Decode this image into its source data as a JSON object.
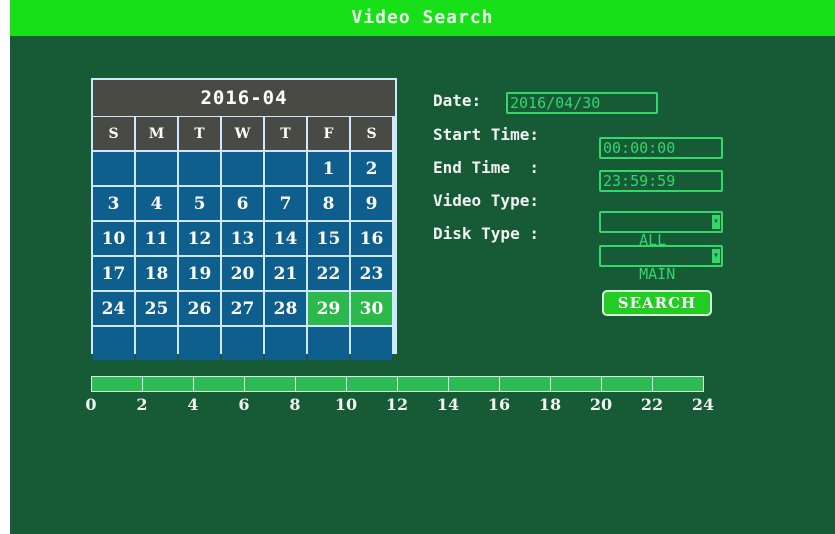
{
  "title": "Video Search",
  "calendar": {
    "month_label": "2016-04",
    "weekdays": [
      "S",
      "M",
      "T",
      "W",
      "T",
      "F",
      "S"
    ],
    "cells": [
      "",
      "",
      "",
      "",
      "",
      "1",
      "2",
      "3",
      "4",
      "5",
      "6",
      "7",
      "8",
      "9",
      "10",
      "11",
      "12",
      "13",
      "14",
      "15",
      "16",
      "17",
      "18",
      "19",
      "20",
      "21",
      "22",
      "23",
      "24",
      "25",
      "26",
      "27",
      "28",
      "29",
      "30",
      "",
      "",
      "",
      "",
      "",
      "",
      ""
    ],
    "recorded_days": [
      "29",
      "30"
    ]
  },
  "form": {
    "date_label": "Date:",
    "date_value": "2016/04/30",
    "start_label": "Start Time:",
    "start_value": "00:00:00",
    "end_label": "End Time  :",
    "end_value": "23:59:59",
    "video_type_label": "Video Type:",
    "video_type_value": "ALL",
    "disk_type_label": "Disk Type :",
    "disk_type_value": "MAIN",
    "search_label": "SEARCH"
  },
  "timeline": {
    "ticks": [
      "0",
      "2",
      "4",
      "6",
      "8",
      "10",
      "12",
      "14",
      "16",
      "18",
      "20",
      "22",
      "24"
    ],
    "segments": 12
  },
  "colors": {
    "background": "#165a36",
    "titlebar": "#18e018",
    "accent": "#33d86a",
    "day_cell": "#0f5f8e",
    "recorded_day": "#2cb84a"
  }
}
